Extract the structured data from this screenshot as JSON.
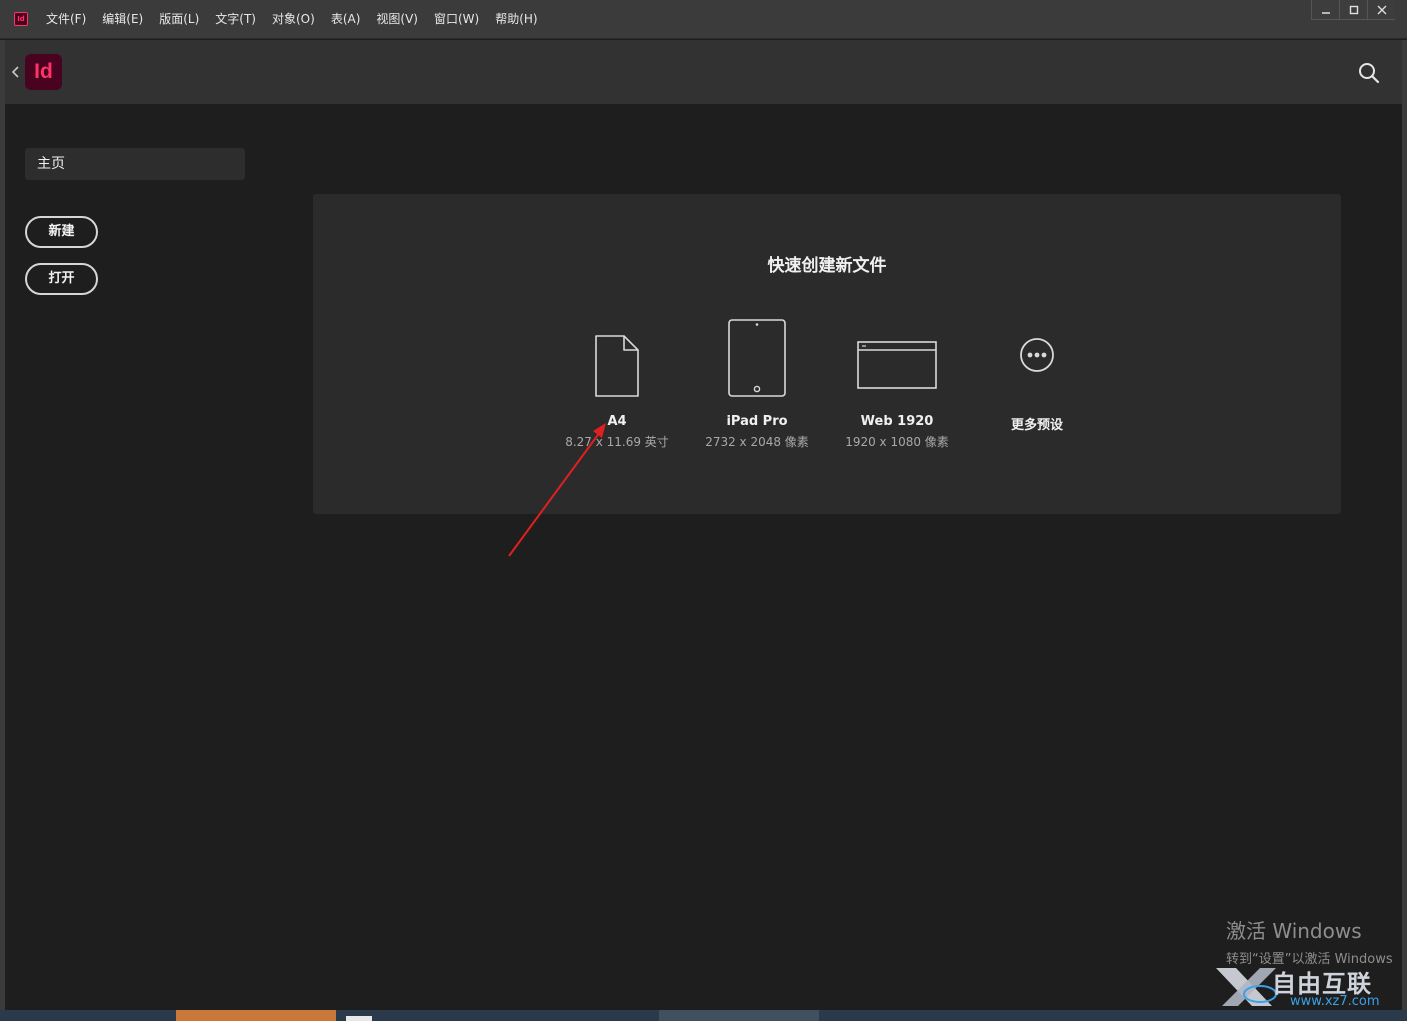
{
  "app": {
    "mini_icon_label": "Id",
    "logo_label": "Id",
    "accent_color": "#ff3366",
    "logo_bg": "#49021f"
  },
  "menu": [
    "文件(F)",
    "编辑(E)",
    "版面(L)",
    "文字(T)",
    "对象(O)",
    "表(A)",
    "视图(V)",
    "窗口(W)",
    "帮助(H)"
  ],
  "window_controls": [
    "minimize-icon",
    "maximize-icon",
    "close-icon"
  ],
  "sidebar": {
    "home_tab": "主页",
    "new_button": "新建",
    "open_button": "打开"
  },
  "quick_create": {
    "title": "快速创建新文件",
    "presets": [
      {
        "name": "A4",
        "size": "8.27 x 11.69 英寸",
        "icon": "document-icon"
      },
      {
        "name": "iPad Pro",
        "size": "2732 x 2048 像素",
        "icon": "tablet-icon"
      },
      {
        "name": "Web 1920",
        "size": "1920 x 1080 像素",
        "icon": "browser-icon"
      },
      {
        "name": "更多预设",
        "size": "",
        "icon": "more-icon"
      }
    ]
  },
  "watermark": {
    "activate_title": "激活 Windows",
    "activate_sub": "转到“设置”以激活 Windows",
    "site_name": "自由互联",
    "site_url": "www.xz7.com"
  }
}
